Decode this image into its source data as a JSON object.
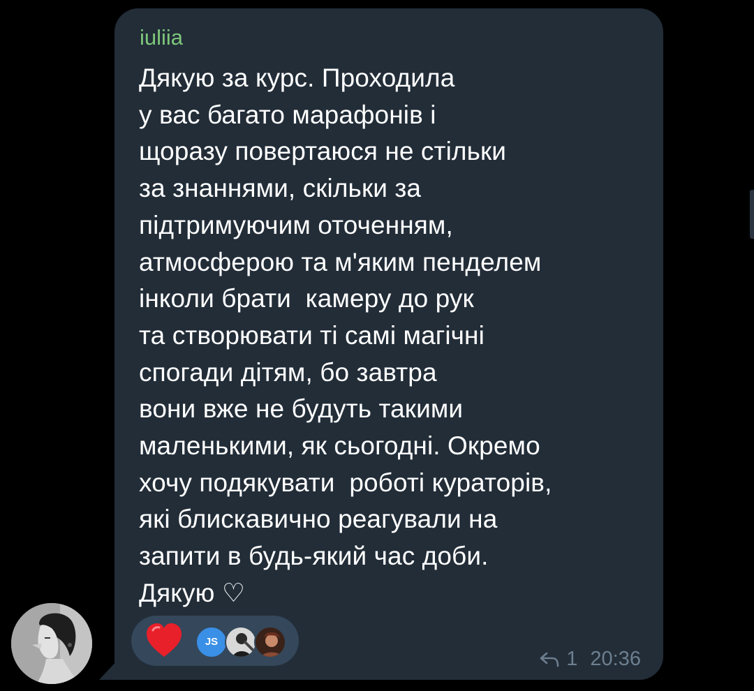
{
  "message": {
    "sender": "iuliia",
    "text_lines": [
      "Дякую за курс. Проходила",
      "у вас багато марафонів і",
      "щоразу повертаюся не стільки",
      "за знаннями, скільки за",
      "підтримуючим оточенням,",
      "атмосферою та м'яким пенделем",
      "інколи брати  камеру до рук",
      "та створювати ті самі магічні",
      "спогади дітям, бо завтра",
      "вони вже не будуть такими",
      "маленькими, як сьогодні. Окремо",
      "хочу подякувати  роботі кураторів,",
      "які блискавично реагували на",
      "запити в будь-який час доби.",
      "Дякую ♡"
    ],
    "reply_count": "1",
    "time": "20:36"
  },
  "reaction": {
    "icon": "heart-icon",
    "reactor_initials": "JS"
  },
  "colors": {
    "background": "#000000",
    "bubble": "#222d38",
    "sender_name": "#7ec77a",
    "text": "#ffffff",
    "meta": "#6d7f8f",
    "reaction_pill": "#34475b",
    "heart": "#e8202a",
    "js_avatar": "#3a8fe6"
  }
}
